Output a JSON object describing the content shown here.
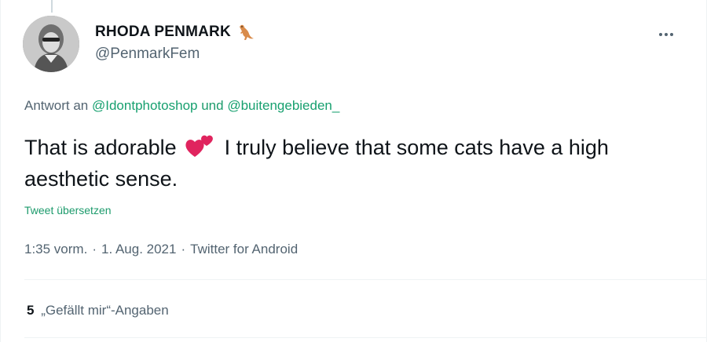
{
  "author": {
    "display_name": "RHODA PENMARK",
    "handle": "@PenmarkFem",
    "name_icon": "kangaroo-icon"
  },
  "menu": {
    "icon": "more-icon"
  },
  "reply": {
    "prefix": "Antwort an",
    "mention_1": "@Idontphotoshop",
    "joiner": "und",
    "mention_2": "@buitengebieden_"
  },
  "tweet": {
    "text_before_emoji": "That is adorable",
    "emoji_icon": "two-hearts-icon",
    "text_after_emoji": "I truly believe that some cats have a high aesthetic sense.",
    "translate_label": "Tweet übersetzen"
  },
  "meta": {
    "time": "1:35 vorm.",
    "separator": "·",
    "date": "1. Aug. 2021",
    "source": "Twitter for Android"
  },
  "stats": {
    "likes_count": "5",
    "likes_label": "„Gefällt mir“-Angaben"
  },
  "colors": {
    "accent": "#1d9b6c",
    "secondary_text": "#536471",
    "primary_text": "#0f1419",
    "heart": "#e0245e"
  }
}
